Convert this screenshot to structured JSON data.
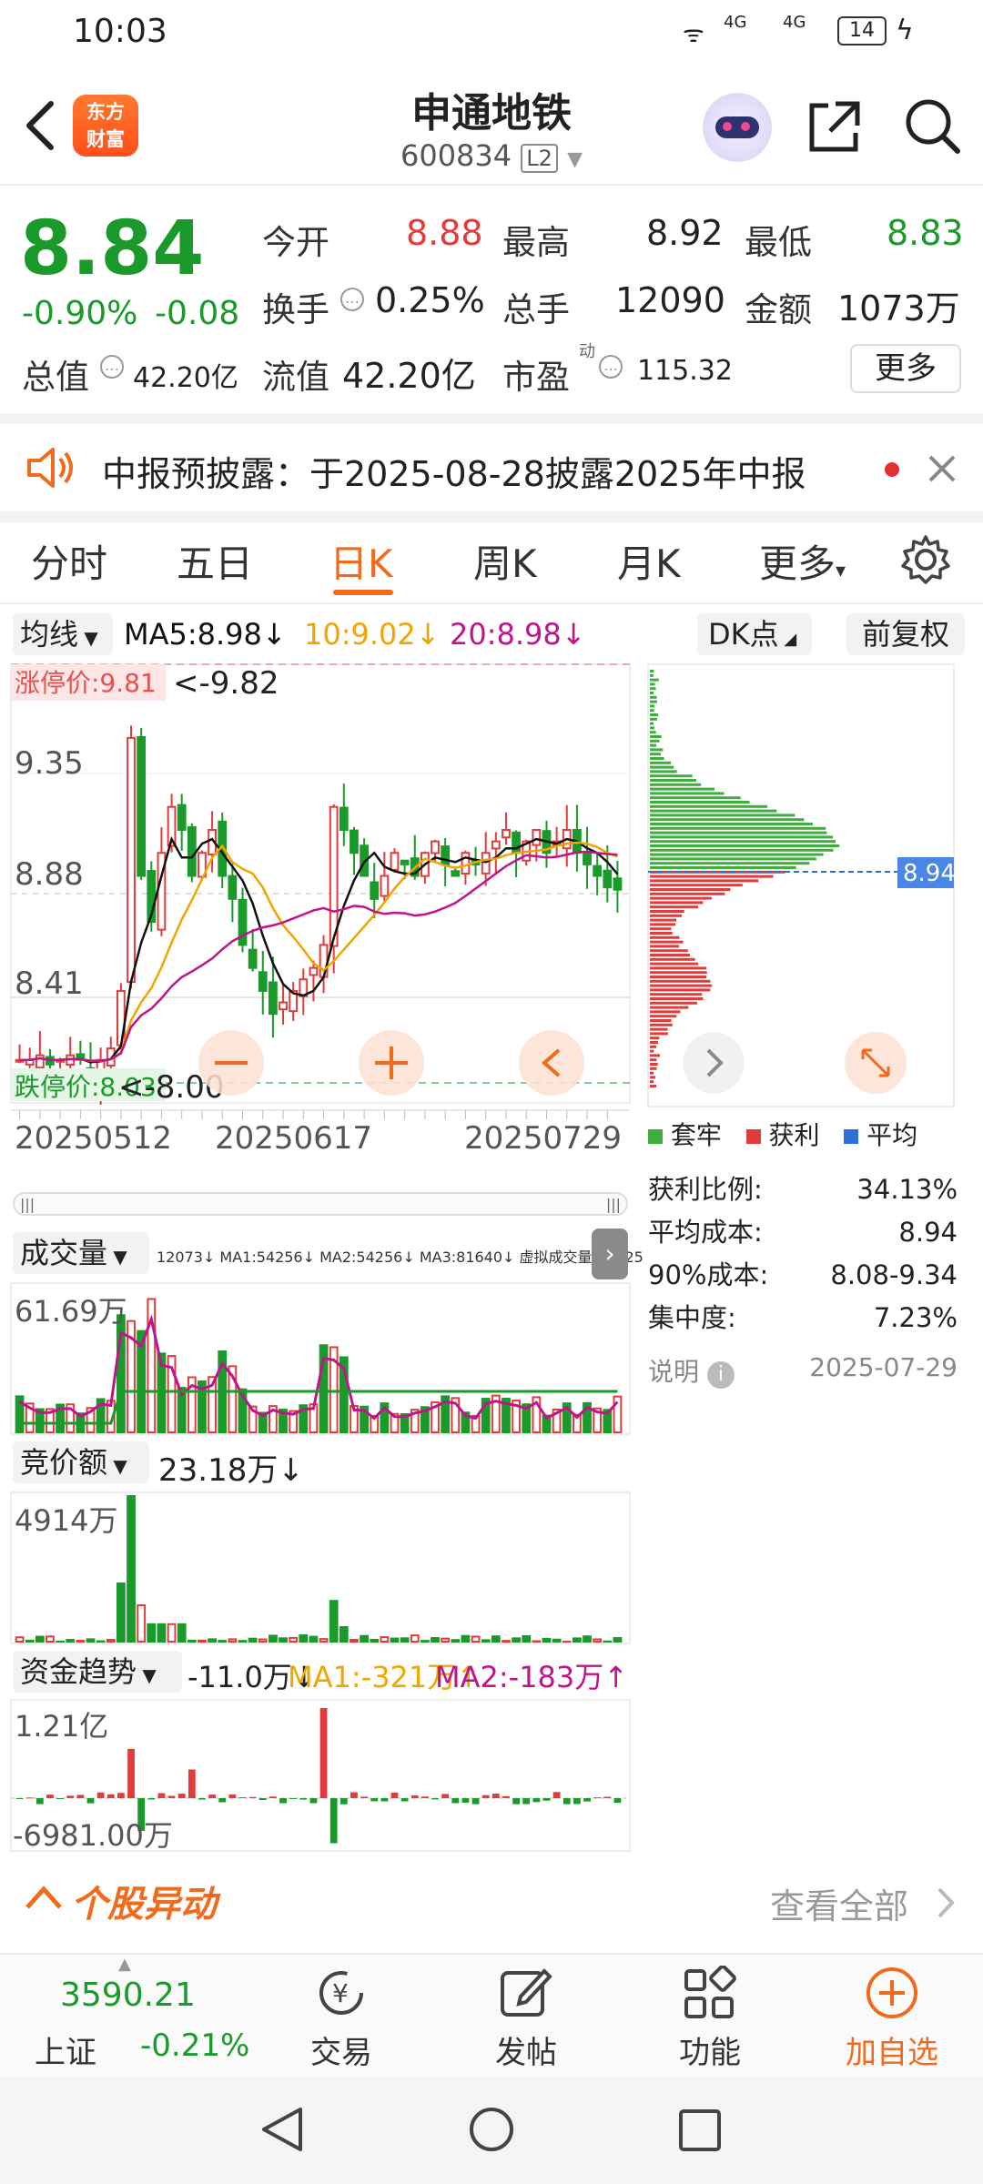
{
  "status_bar": {
    "time": "10:03",
    "signal_label": "4G",
    "battery": "14"
  },
  "header": {
    "logo_text_1": "东方",
    "logo_text_2": "财富",
    "title": "申通地铁",
    "code": "600834",
    "level": "L2"
  },
  "quote": {
    "price": "8.84",
    "change_pct": "-0.90%",
    "change": "-0.08",
    "open_label": "今开",
    "open": "8.88",
    "high_label": "最高",
    "high": "8.92",
    "low_label": "最低",
    "low": "8.83",
    "turnover_label": "换手",
    "turnover": "0.25%",
    "volume_label": "总手",
    "volume": "12090",
    "amount_label": "金额",
    "amount": "1073万",
    "mcap_label": "总值",
    "mcap": "42.20亿",
    "float_label": "流值",
    "float": "42.20亿",
    "pe_label": "市盈",
    "pe_sup": "动",
    "pe": "115.32",
    "more": "更多"
  },
  "notice": {
    "text": "中报预披露：于2025-08-28披露2025年中报"
  },
  "tabs": [
    "分时",
    "五日",
    "日K",
    "周K",
    "月K",
    "更多"
  ],
  "active_tab": "日K",
  "kline": {
    "ma_selector": "均线",
    "ma5": "MA5:8.98↓",
    "ma10": "10:9.02↓",
    "ma20": "20:8.98↓",
    "dk": "DK点",
    "fq": "前复权",
    "limit_up": "涨停价:9.81",
    "max_mark": "<-9.82",
    "limit_down": "跌停价:8.03",
    "min_mark": "<-8.00",
    "y_labels": [
      "9.35",
      "8.88",
      "8.41"
    ],
    "dates": [
      "20250512",
      "20250617",
      "20250729"
    ]
  },
  "chips": {
    "price_tag": "8.94",
    "legend": [
      "套牢",
      "获利",
      "平均"
    ],
    "rows": [
      {
        "k": "获利比例:",
        "v": "34.13%"
      },
      {
        "k": "平均成本:",
        "v": "8.94"
      },
      {
        "k": "90%成本:",
        "v": "8.08-9.34"
      },
      {
        "k": "集中度:",
        "v": "7.23%"
      }
    ],
    "note_label": "说明",
    "date": "2025-07-29"
  },
  "volume": {
    "selector": "成交量",
    "legend": "12073↓ MA1:54256↓ MA2:54256↓ MA3:81640↓ 虚拟成交量:68225",
    "ymax": "61.69万"
  },
  "auction": {
    "selector": "竞价额",
    "value": "23.18万↓",
    "ymax": "4914万"
  },
  "fund": {
    "selector": "资金趋势",
    "value": "-11.0万↓",
    "ma1": "MA1:-321万↑",
    "ma2": "MA2:-183万↑",
    "ymax": "1.21亿",
    "ymin": "-6981.00万"
  },
  "movement": {
    "title": "个股异动",
    "all": "查看全部"
  },
  "bottom": {
    "index_value": "3590.21",
    "index_name": "上证",
    "index_change": "-0.21%",
    "nav": [
      "交易",
      "发帖",
      "功能",
      "加自选"
    ]
  },
  "colors": {
    "up": "#e23b3b",
    "down": "#1a9a2a",
    "accent": "#f26a1b",
    "ma5": "#111111",
    "ma10": "#f0a500",
    "ma20": "#c0148c"
  }
}
